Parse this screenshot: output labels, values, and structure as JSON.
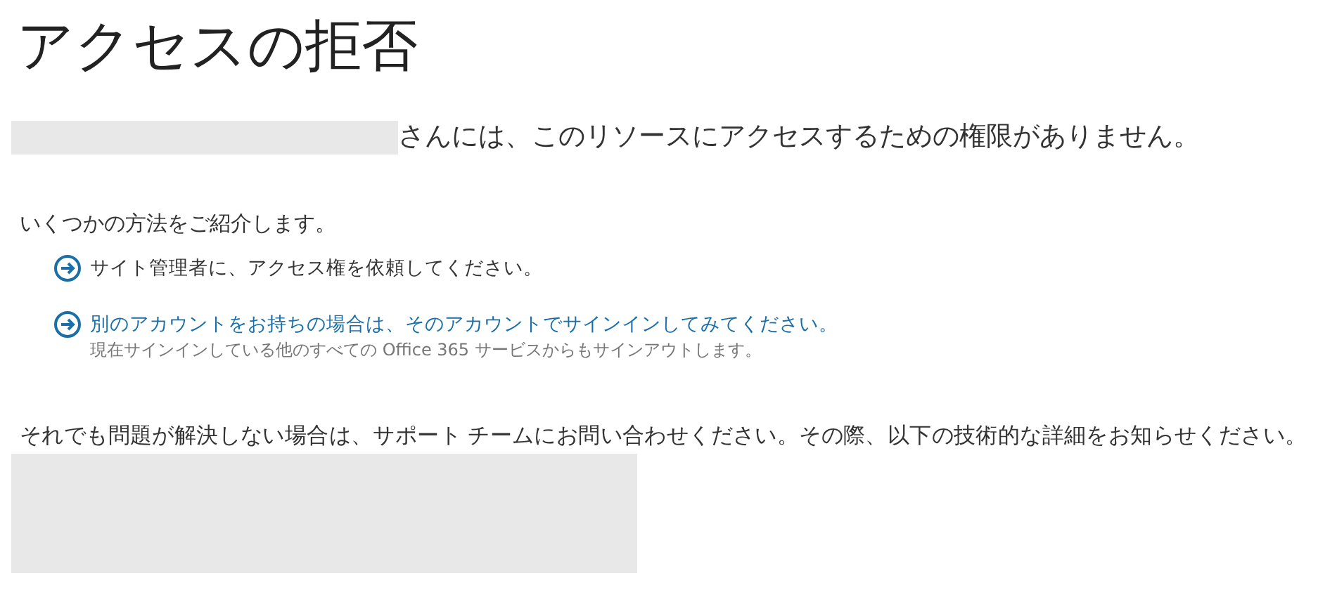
{
  "title": "アクセスの拒否",
  "message": "さんには、このリソースにアクセスするための権限がありません。",
  "intro": "いくつかの方法をご紹介します。",
  "options": [
    {
      "kind": "text",
      "label": "サイト管理者に、アクセス権を依頼してください。"
    },
    {
      "kind": "link",
      "label": "別のアカウントをお持ちの場合は、そのアカウントでサインインしてみてください。",
      "note": "現在サインインしている他のすべての Office 365 サービスからもサインアウトします。"
    }
  ],
  "support": "それでも問題が解決しない場合は、サポート チームにお問い合わせください。その際、以下の技術的な詳細をお知らせください。"
}
